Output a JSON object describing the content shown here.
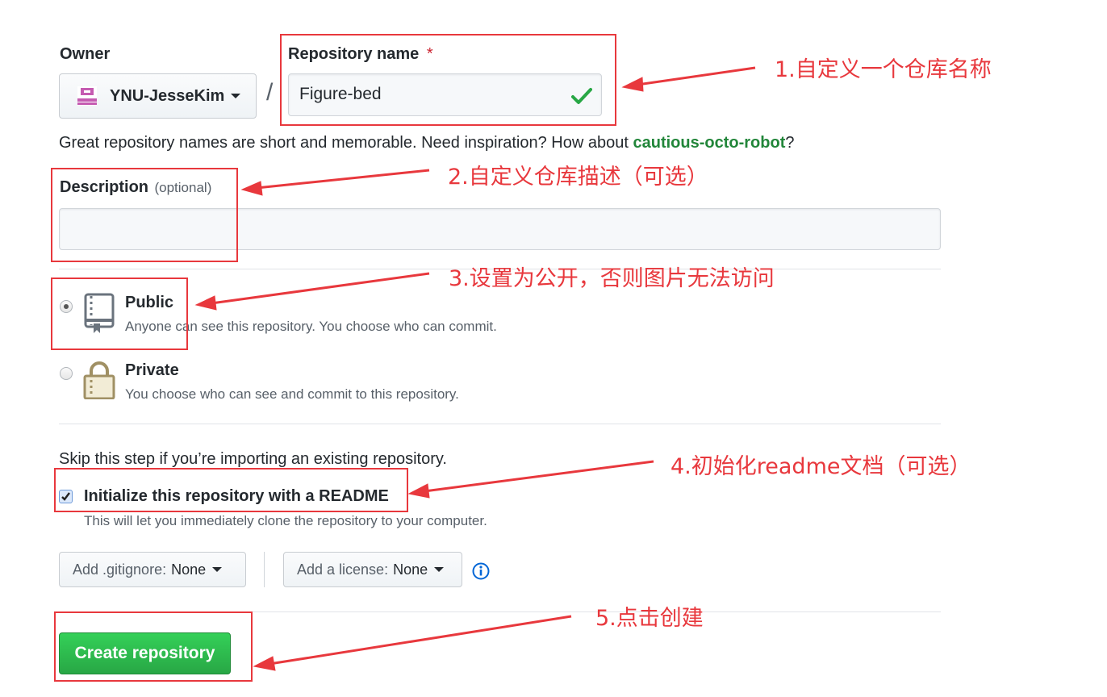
{
  "owner": {
    "label": "Owner",
    "value": "YNU-JesseKim"
  },
  "slash": "/",
  "repo_name": {
    "label": "Repository name",
    "required_mark": "*",
    "value": "Figure-bed"
  },
  "name_hint": {
    "text": "Great repository names are short and memorable. Need inspiration? How about ",
    "suggestion": "cautious-octo-robot",
    "end": "?"
  },
  "description": {
    "label": "Description",
    "optional": "(optional)",
    "value": ""
  },
  "visibility": {
    "public": {
      "title": "Public",
      "desc": "Anyone can see this repository. You choose who can commit.",
      "checked": true
    },
    "private": {
      "title": "Private",
      "desc": "You choose who can see and commit to this repository.",
      "checked": false
    }
  },
  "init": {
    "skip_text": "Skip this step if you’re importing an existing repository.",
    "checkbox_label": "Initialize this repository with a README",
    "checkbox_desc": "This will let you immediately clone the repository to your computer.",
    "checked": true
  },
  "gitignore": {
    "prefix": "Add .gitignore:",
    "value": "None"
  },
  "license": {
    "prefix": "Add a license:",
    "value": "None"
  },
  "create_button": "Create repository",
  "annotations": {
    "a1": "1.自定义一个仓库名称",
    "a2": "2.自定义仓库描述（可选）",
    "a3": "3.设置为公开，否则图片无法访问",
    "a4": "4.初始化readme文档（可选）",
    "a5": "5.点击创建"
  },
  "colors": {
    "annotation_red": "#e8383d",
    "suggestion_green": "#22863a",
    "create_green": "#28a745",
    "check_green": "#28a745"
  }
}
